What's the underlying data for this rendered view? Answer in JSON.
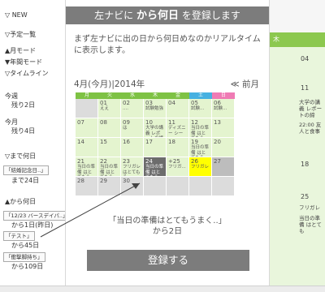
{
  "sidebar": {
    "new_label": "▽ NEW",
    "schedule_list": "▽予定一覧",
    "month_mode": "▲月モード",
    "year_mode": "▼年間モード",
    "timeline": "▽タイムライン",
    "this_week": "今週",
    "this_week_count": "残り2日",
    "this_month": "今月",
    "this_month_count": "残り4日",
    "until_label": "▽まで何日",
    "until_item": "「結婚記念日..」",
    "until_count": "まで24日",
    "since_label": "▲から何日",
    "since_items": [
      {
        "label": "「12/23 バースデイパ..」",
        "count": "から1日(昨日)"
      },
      {
        "label": "「テスト」",
        "count": "から45日"
      },
      {
        "label": "「衝撃脚持ち」",
        "count": "から109日"
      }
    ]
  },
  "background": {
    "right_header": "木",
    "nums": [
      "04",
      "11",
      "18",
      "25"
    ],
    "texts": [
      "大学の講義 レポートの締",
      "22:00 友人と食事",
      "フリガレ",
      "当日の準備 はとても"
    ]
  },
  "modal": {
    "title_pre": "左ナビに",
    "title_bold": "から何日",
    "title_post": "を登録します",
    "description": "まず左ナビに出の日から何日めなのかリアルタイムに表示します。",
    "month_label": "4月(今月)|2014年",
    "prev_month": "≪ 前月",
    "weekdays": [
      "月",
      "火",
      "水",
      "木",
      "金",
      "土",
      "日"
    ],
    "weeks": [
      [
        {
          "d": "",
          "t": "",
          "k": "out"
        },
        {
          "d": "01",
          "t": "ええ",
          "k": ""
        },
        {
          "d": "02",
          "t": "....",
          "k": ""
        },
        {
          "d": "03",
          "t": "試験勉強",
          "k": ""
        },
        {
          "d": "04",
          "t": "",
          "k": ""
        },
        {
          "d": "05",
          "t": "試験...",
          "k": ""
        },
        {
          "d": "06",
          "t": "試験...",
          "k": ""
        }
      ],
      [
        {
          "d": "07",
          "t": "",
          "k": ""
        },
        {
          "d": "08",
          "t": "",
          "k": ""
        },
        {
          "d": "09",
          "t": "は",
          "k": ""
        },
        {
          "d": "10",
          "t": "大学の講義 レポートの締",
          "k": ""
        },
        {
          "d": "11",
          "t": "ディズニー シー",
          "k": ""
        },
        {
          "d": "12",
          "t": "当日の準備 はとてもう",
          "k": ""
        },
        {
          "d": "13",
          "t": "",
          "k": ""
        }
      ],
      [
        {
          "d": "14",
          "t": "",
          "k": ""
        },
        {
          "d": "15",
          "t": "",
          "k": ""
        },
        {
          "d": "16",
          "t": "",
          "k": ""
        },
        {
          "d": "17",
          "t": "",
          "k": ""
        },
        {
          "d": "18",
          "t": "",
          "k": ""
        },
        {
          "d": "19",
          "t": "当日の準備 はとてもう",
          "k": ""
        },
        {
          "d": "20",
          "t": "",
          "k": ""
        }
      ],
      [
        {
          "d": "21",
          "t": "当日の準備 はとてもう",
          "k": ""
        },
        {
          "d": "22",
          "t": "当日の準備 はとてもう",
          "k": ""
        },
        {
          "d": "23",
          "t": "フリガレ はとてもう",
          "k": ""
        },
        {
          "d": "24",
          "t": "当日の準備 はとてもう",
          "k": "sel"
        },
        {
          "d": "+25",
          "t": "フリガ...",
          "k": ""
        },
        {
          "d": "26",
          "t": "フリガレ",
          "k": "yel"
        },
        {
          "d": "27",
          "t": "",
          "k": "gray"
        }
      ],
      [
        {
          "d": "28",
          "t": "",
          "k": "out"
        },
        {
          "d": "29",
          "t": "",
          "k": "out"
        },
        {
          "d": "30",
          "t": "",
          "k": "out"
        },
        {
          "d": "",
          "t": "",
          "k": "out"
        },
        {
          "d": "",
          "t": "",
          "k": "out"
        },
        {
          "d": "",
          "t": "",
          "k": "out"
        },
        {
          "d": "",
          "t": "",
          "k": "out"
        }
      ]
    ],
    "quote_line1": "「当日の準備はとてもうまく..」",
    "quote_line2": "から2日",
    "register_button": "登録する"
  },
  "colors": {
    "weekday_header": "#7ec244",
    "saturday_header": "#46b1e1",
    "sunday_header": "#ef7bb4"
  }
}
